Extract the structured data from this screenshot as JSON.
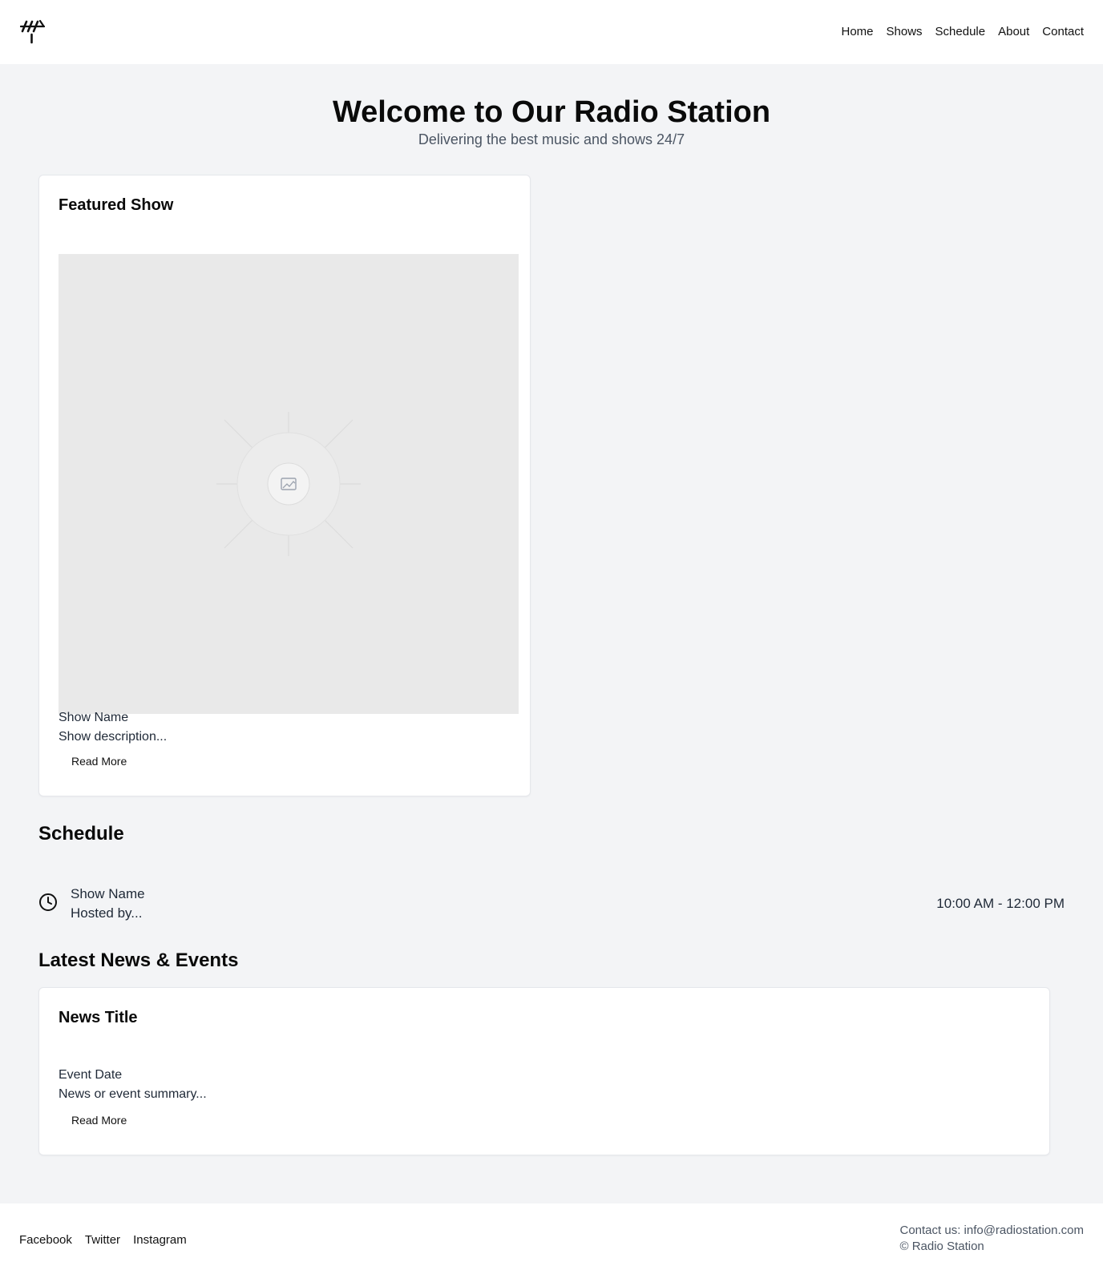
{
  "header": {
    "logo_icon": "radio-antenna-logo-icon",
    "nav": [
      {
        "label": "Home"
      },
      {
        "label": "Shows"
      },
      {
        "label": "Schedule"
      },
      {
        "label": "About"
      },
      {
        "label": "Contact"
      }
    ]
  },
  "hero": {
    "title": "Welcome to Our Radio Station",
    "subtitle": "Delivering the best music and shows 24/7"
  },
  "featured": {
    "heading": "Featured Show",
    "image_icon": "image-placeholder-icon",
    "show_name": "Show Name",
    "description": "Show description...",
    "read_more": "Read More"
  },
  "schedule": {
    "heading": "Schedule",
    "items": [
      {
        "icon": "clock-icon",
        "name": "Show Name",
        "host": "Hosted by...",
        "time": "10:00 AM - 12:00 PM"
      }
    ]
  },
  "news": {
    "heading": "Latest News & Events",
    "items": [
      {
        "title": "News Title",
        "date": "Event Date",
        "summary": "News or event summary...",
        "read_more": "Read More"
      }
    ]
  },
  "footer": {
    "social": [
      {
        "label": "Facebook"
      },
      {
        "label": "Twitter"
      },
      {
        "label": "Instagram"
      }
    ],
    "contact": "Contact us: info@radiostation.com",
    "copyright": "© Radio Station"
  },
  "colors": {
    "page_background": "#f3f4f6",
    "surface": "#ffffff",
    "image_placeholder": "#e9e9e9",
    "muted_text": "#4b5563"
  }
}
